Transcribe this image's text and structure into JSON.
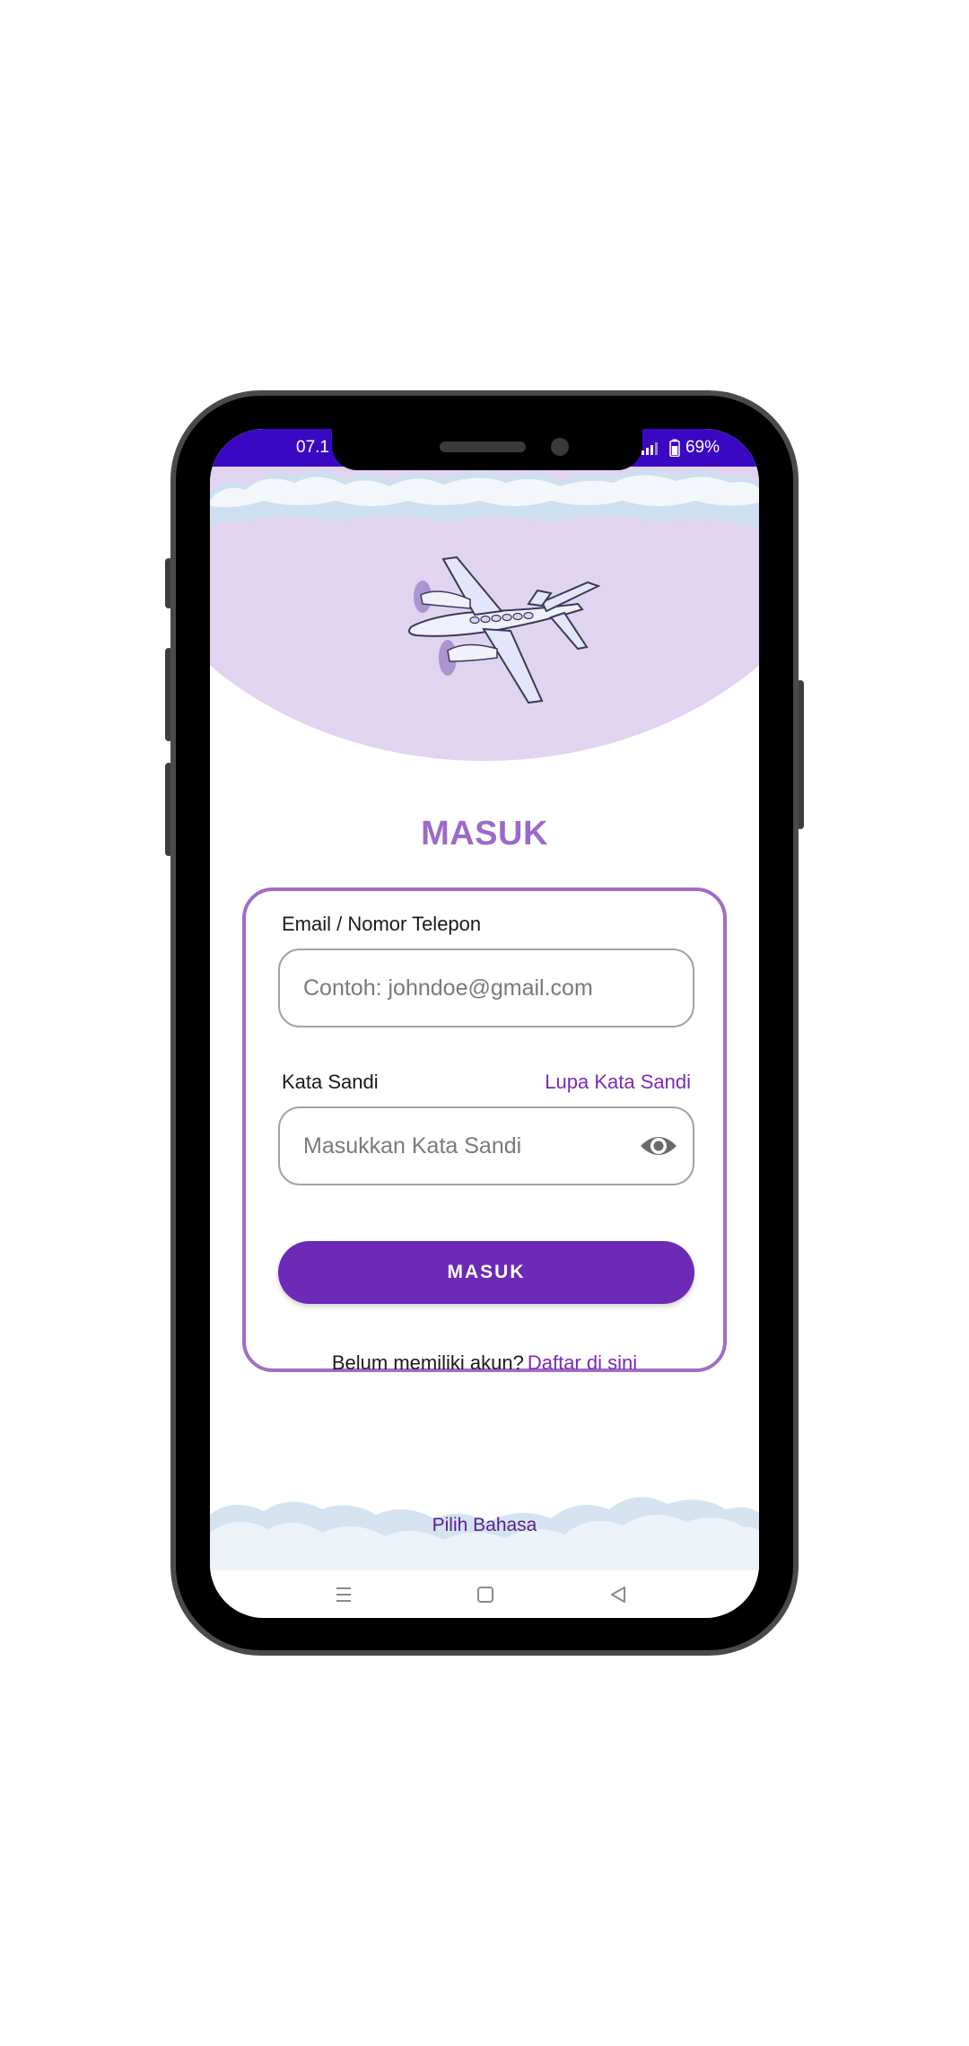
{
  "status_bar": {
    "time": "07.1",
    "battery": "69%",
    "bg_color": "#3a08c2"
  },
  "header": {
    "title": "MASUK",
    "illustration": "airplane-icon"
  },
  "form": {
    "email": {
      "label": "Email / Nomor Telepon",
      "placeholder": "Contoh: johndoe@gmail.com"
    },
    "password": {
      "label": "Kata Sandi",
      "forgot_link": "Lupa Kata Sandi",
      "placeholder": "Masukkan Kata Sandi",
      "toggle_icon": "eye-icon"
    },
    "submit_label": "MASUK",
    "register": {
      "prompt": "Belum memiliki akun?",
      "link": "Daftar di sini"
    }
  },
  "footer": {
    "language_link": "Pilih Bahasa"
  },
  "nav_bar": {
    "items": [
      "menu-icon",
      "home-icon",
      "back-icon"
    ]
  },
  "colors": {
    "accent": "#6c2ab6",
    "title": "#9b6ac9",
    "hero_bg": "#e0d4f0"
  }
}
